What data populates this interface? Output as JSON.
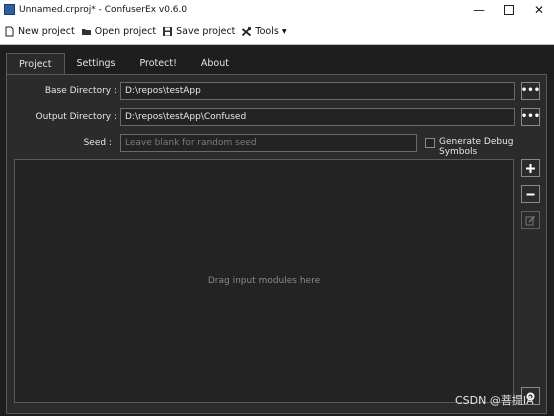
{
  "window": {
    "title": "Unnamed.crproj* - ConfuserEx v0.6.0",
    "minimize": "—",
    "close": "✕"
  },
  "toolbar": {
    "new_project": "New project",
    "open_project": "Open project",
    "save_project": "Save project",
    "tools": "Tools ▾"
  },
  "tabs": [
    "Project",
    "Settings",
    "Protect!",
    "About"
  ],
  "project": {
    "base_dir_label": "Base Directory :",
    "base_dir_value": "D:\\repos\\testApp",
    "output_dir_label": "Output Directory :",
    "output_dir_value": "D:\\repos\\testApp\\Confused",
    "seed_label": "Seed :",
    "seed_placeholder": "Leave blank for random seed",
    "debug_symbols_label": "Generate Debug Symbols",
    "drop_hint": "Drag input modules here",
    "browse": "•••"
  },
  "watermark": "CSDN @菩提IA",
  "colors": {
    "accent": "#2d5f9a",
    "panel": "#2b2b2b",
    "background": "#1e1e1e"
  }
}
